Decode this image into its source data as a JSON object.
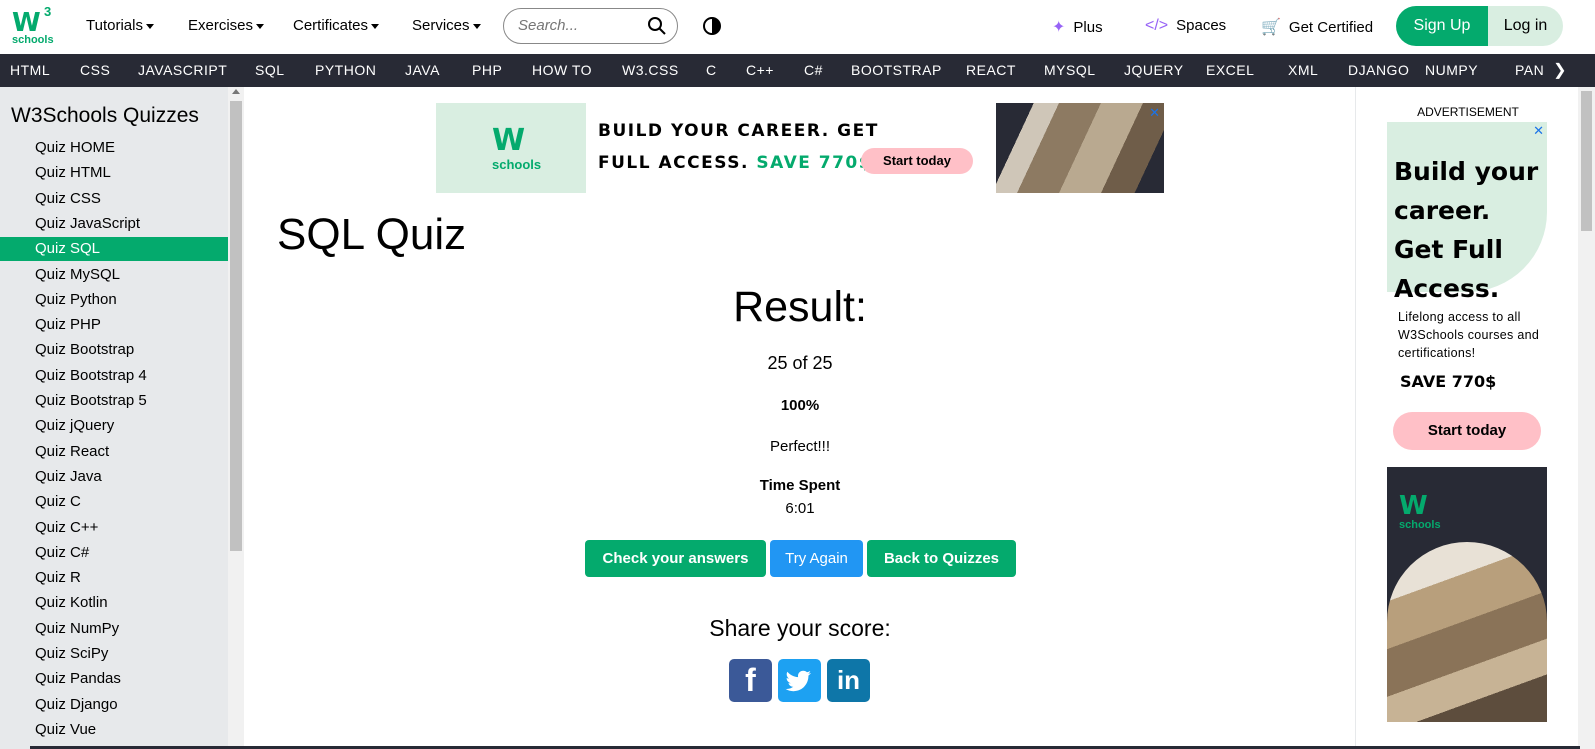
{
  "brand": {
    "logo_main": "W",
    "logo_sup": "3",
    "logo_sub": "schools"
  },
  "topnav": {
    "tutorials": "Tutorials",
    "exercises": "Exercises",
    "certificates": "Certificates",
    "services": "Services",
    "search_placeholder": "Search...",
    "plus": "Plus",
    "spaces": "Spaces",
    "get_certified": "Get Certified",
    "sign_up": "Sign Up",
    "log_in": "Log in"
  },
  "subnav": [
    "HTML",
    "CSS",
    "JAVASCRIPT",
    "SQL",
    "PYTHON",
    "JAVA",
    "PHP",
    "HOW TO",
    "W3.CSS",
    "C",
    "C++",
    "C#",
    "BOOTSTRAP",
    "REACT",
    "MYSQL",
    "JQUERY",
    "EXCEL",
    "XML",
    "DJANGO",
    "NUMPY",
    "PAN"
  ],
  "sidebar": {
    "title": "W3Schools Quizzes",
    "items": [
      "Quiz HOME",
      "Quiz HTML",
      "Quiz CSS",
      "Quiz JavaScript",
      "Quiz SQL",
      "Quiz MySQL",
      "Quiz Python",
      "Quiz PHP",
      "Quiz Bootstrap",
      "Quiz Bootstrap 4",
      "Quiz Bootstrap 5",
      "Quiz jQuery",
      "Quiz React",
      "Quiz Java",
      "Quiz C",
      "Quiz C++",
      "Quiz C#",
      "Quiz R",
      "Quiz Kotlin",
      "Quiz NumPy",
      "Quiz SciPy",
      "Quiz Pandas",
      "Quiz Django",
      "Quiz Vue"
    ],
    "active_index": 4
  },
  "banner_ad": {
    "line1": "BUILD YOUR CAREER. GET",
    "line2": "FULL ACCESS.",
    "save": "SAVE 770$",
    "button": "Start today",
    "close": "✕"
  },
  "main": {
    "title": "SQL Quiz",
    "result_heading": "Result:",
    "score": "25 of 25",
    "percent": "100%",
    "verdict": "Perfect!!!",
    "time_label": "Time Spent",
    "time_value": "6:01",
    "check_button": "Check your answers",
    "try_again_button": "Try Again",
    "back_button": "Back to Quizzes",
    "share_heading": "Share your score:",
    "social": {
      "facebook": "f",
      "twitter": "🐦",
      "linkedin": "in"
    }
  },
  "side_ad": {
    "label": "ADVERTISEMENT",
    "headline": "Build your career. Get Full Access.",
    "body": "Lifelong access to all W3Schools courses and certifications!",
    "save": "SAVE 770$",
    "button": "Start today",
    "close": "✕"
  },
  "colors": {
    "accent": "#04aa6d",
    "dark": "#282a35",
    "blue": "#2196f3",
    "pink": "#ffc0c7",
    "mint": "#d9eee1"
  }
}
